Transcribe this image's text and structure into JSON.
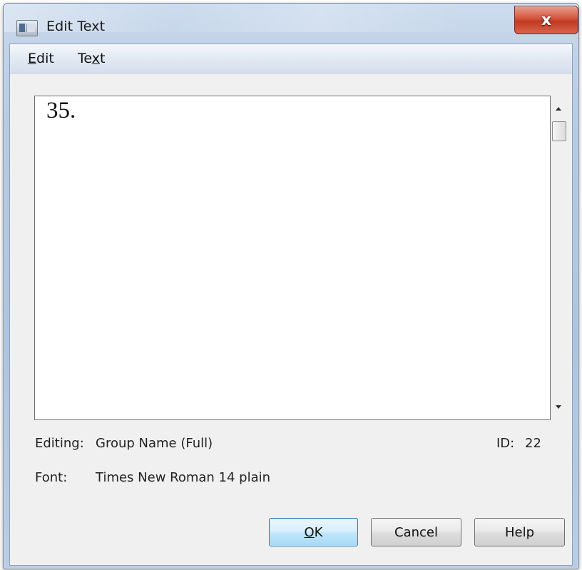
{
  "window": {
    "title": "Edit Text",
    "close_glyph": "x"
  },
  "menu": {
    "items": [
      {
        "label_underlined": "E",
        "label_rest": "dit"
      },
      {
        "label_before": "Te",
        "label_underlined": "x",
        "label_after": "t"
      }
    ]
  },
  "editor": {
    "content": "35."
  },
  "info": {
    "editing_label": "Editing:",
    "editing_value": "Group Name (Full)",
    "id_label": "ID:",
    "id_value": "22",
    "font_label": "Font:",
    "font_value": "Times New Roman 14 plain"
  },
  "buttons": {
    "ok_underlined": "O",
    "ok_rest": "K",
    "cancel": "Cancel",
    "help": "Help"
  },
  "icons": {
    "app": "dialog-window-icon",
    "close": "close-icon",
    "scroll_up": "scroll-up-arrow-icon",
    "scroll_down": "scroll-down-arrow-icon"
  }
}
